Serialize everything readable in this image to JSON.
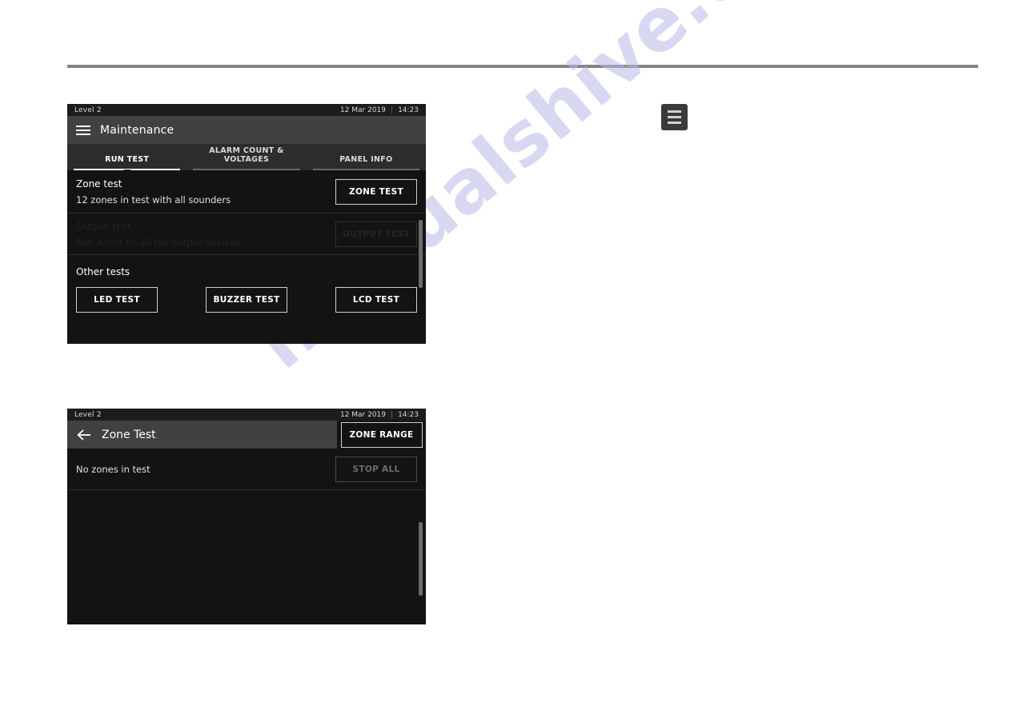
{
  "page": {
    "watermark": "manualshive.com"
  },
  "callout": {
    "menu_icon_name": "hamburger-menu-icon"
  },
  "panel_run_test": {
    "status_bar": {
      "level": "Level 2",
      "date": "12 Mar 2019",
      "separator": "|",
      "time": "14:23"
    },
    "header": {
      "title": "Maintenance"
    },
    "tabs": [
      {
        "label": "RUN TEST",
        "active": true
      },
      {
        "label": "ALARM COUNT & VOLTAGES",
        "active": false
      },
      {
        "label": "PANEL INFO",
        "active": false
      }
    ],
    "rows": [
      {
        "title": "Zone test",
        "subtitle": "12 zones in test with all sounders",
        "button": "ZONE TEST",
        "disabled": false
      },
      {
        "title": "Output test",
        "subtitle": "Run a test on all the output devices",
        "button": "OUTPUT TEST",
        "disabled": true
      }
    ],
    "other_tests": {
      "section_label": "Other tests",
      "buttons": [
        {
          "label": "LED TEST"
        },
        {
          "label": "BUZZER TEST"
        },
        {
          "label": "LCD TEST"
        }
      ]
    }
  },
  "panel_zone_test": {
    "status_bar": {
      "level": "Level 2",
      "date": "12 Mar 2019",
      "separator": "|",
      "time": "14:23"
    },
    "header": {
      "title": "Zone Test",
      "back_icon_name": "back-arrow-icon",
      "action_button": "ZONE RANGE"
    },
    "content": {
      "status_text": "No zones in test",
      "stop_button": "STOP ALL"
    }
  },
  "colors": {
    "panel_bg": "#131313",
    "header_bg": "#414141",
    "tabs_bg": "#2c2c2c",
    "status_bg": "#1c1c1c",
    "accent_white": "#ffffff",
    "disabled_text": "#232323",
    "dim_text": "#6d6d6d",
    "rule_gray": "#848484",
    "watermark": "#b9b9e8"
  }
}
